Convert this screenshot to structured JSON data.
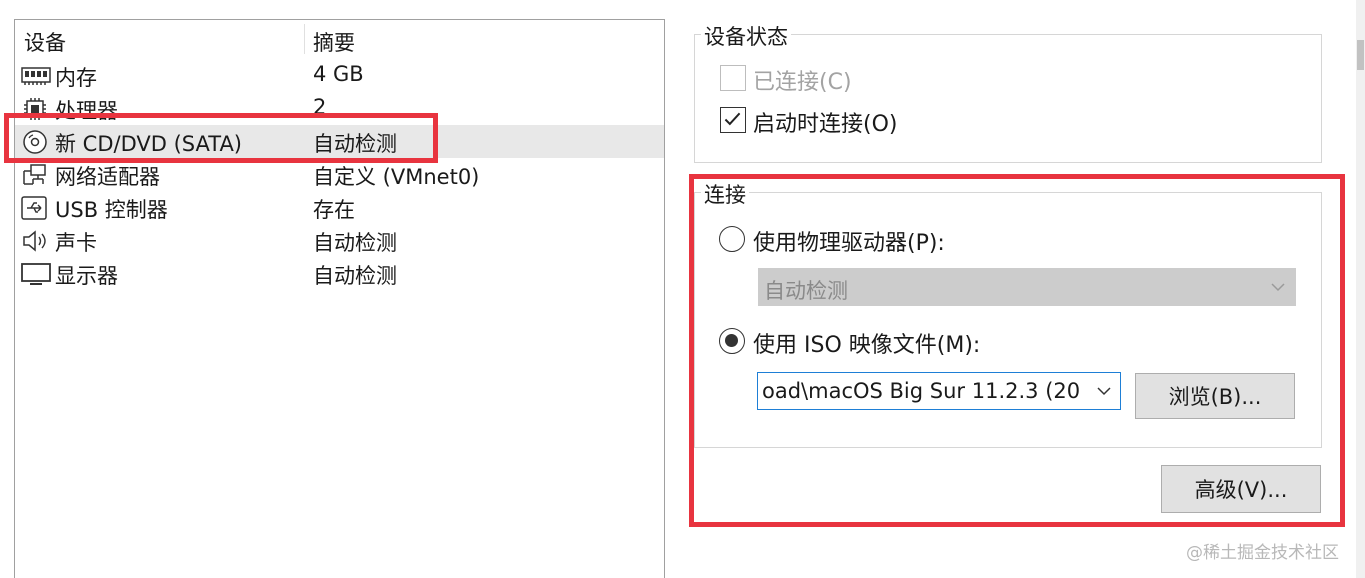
{
  "device_list": {
    "col_device": "设备",
    "col_summary": "摘要",
    "devices": [
      {
        "name": "内存",
        "summary": "4 GB",
        "icon": "memory-icon"
      },
      {
        "name": "处理器",
        "summary": "2",
        "icon": "processor-icon"
      },
      {
        "name": "新 CD/DVD (SATA)",
        "summary": "自动检测",
        "icon": "cd-dvd-icon",
        "selected": true
      },
      {
        "name": "网络适配器",
        "summary": "自定义 (VMnet0)",
        "icon": "network-adapter-icon"
      },
      {
        "name": "USB 控制器",
        "summary": "存在",
        "icon": "usb-icon"
      },
      {
        "name": "声卡",
        "summary": "自动检测",
        "icon": "speaker-icon"
      },
      {
        "name": "显示器",
        "summary": "自动检测",
        "icon": "monitor-icon"
      }
    ]
  },
  "device_status": {
    "title": "设备状态",
    "connected_label": "已连接(C)",
    "connected_checked": false,
    "connected_enabled": false,
    "connect_at_power_on_label": "启动时连接(O)",
    "connect_at_power_on_checked": true
  },
  "connection": {
    "title": "连接",
    "physical_drive_label": "使用物理驱动器(P):",
    "physical_drive_selected": false,
    "physical_drive_value": "自动检测",
    "iso_label": "使用 ISO 映像文件(M):",
    "iso_selected": true,
    "iso_path": "oad\\macOS Big Sur 11.2.3 (20",
    "browse_label": "浏览(B)...",
    "advanced_label": "高级(V)..."
  },
  "watermark": "@稀土掘金技术社区",
  "colors": {
    "highlight_border": "#e8343f",
    "focus_border": "#1e7fd6",
    "selected_row": "#e8e8e8"
  }
}
